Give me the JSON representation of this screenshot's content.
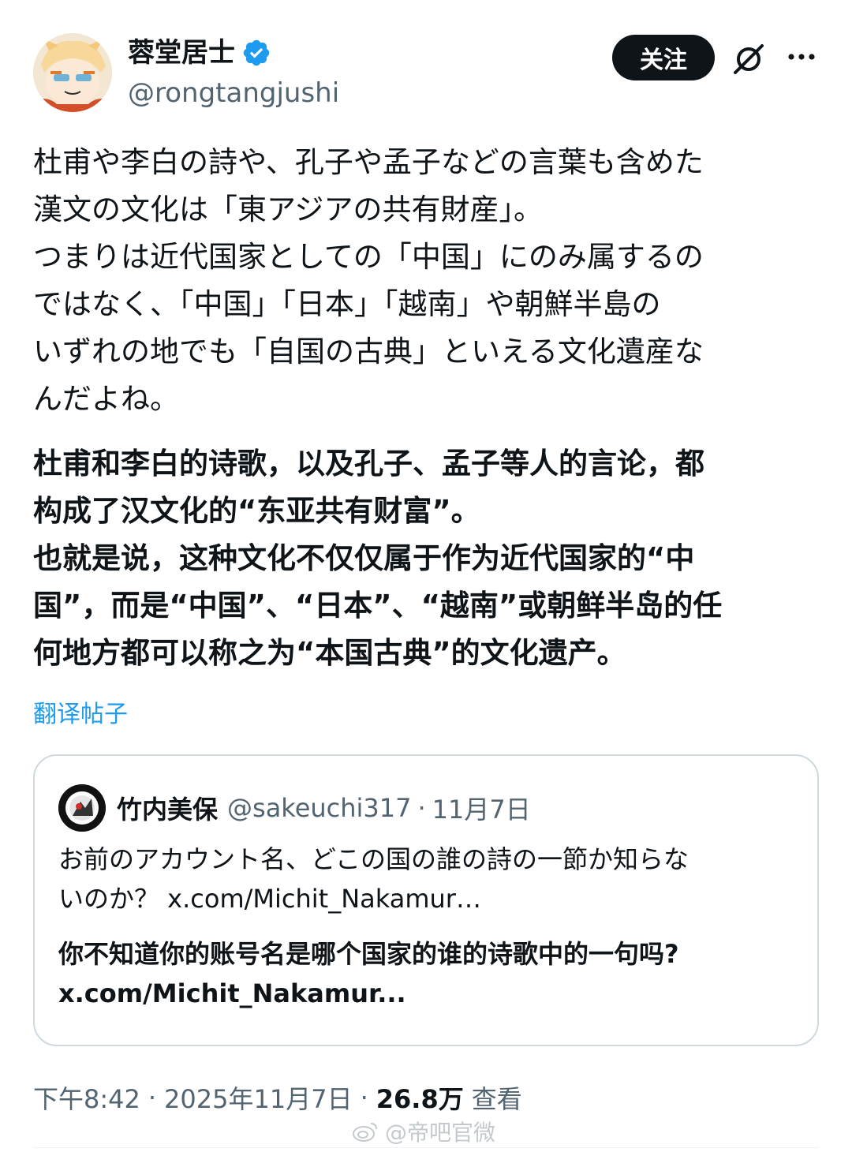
{
  "colors": {
    "accent": "#1d9bf0",
    "text_primary": "#0f1419",
    "text_secondary": "#536471",
    "follow_bg": "#0f1419",
    "card_border": "#cfd9de"
  },
  "author": {
    "display_name": "蓉堂居士",
    "handle": "@rongtangjushi",
    "verified_icon": "verified-badge-icon",
    "avatar": "anime-avatar"
  },
  "actions": {
    "follow_label": "关注",
    "grok_icon": "grok-icon",
    "more_icon": "more-horizontal-icon"
  },
  "post": {
    "text": "杜甫や李白の詩や、孔子や孟子などの言葉も含めた\n漢文の文化は「東アジアの共有財産」。\nつまりは近代国家としての「中国」にのみ属するの\nではなく、「中国」「日本」「越南」や朝鮮半島の\nいずれの地でも「自国の古典」といえる文化遺産な\nんだよね。",
    "translation": "杜甫和李白的诗歌，以及孔子、孟子等人的言论，都\n构成了汉文化的“东亚共有财富”。\n也就是说，这种文化不仅仅属于作为近代国家的“中\n国”，而是“中国”、“日本”、“越南”或朝鲜半岛的任\n何地方都可以称之为“本国古典”的文化遗产。",
    "translate_link": "翻译帖子"
  },
  "quote": {
    "display_name": "竹内美保",
    "handle": "@sakeuchi317",
    "separator": "·",
    "date": "11月7日",
    "text": "お前のアカウント名、どこの国の誰の詩の一節か知らな\nいのか？ x.com/Michit_Nakamur…",
    "translation": "你不知道你的账号名是哪个国家的谁的诗歌中的一句吗?\nx.com/Michit_Nakamur..."
  },
  "meta": {
    "time": "下午8:42",
    "separator": "·",
    "date": "2025年11月7日",
    "views_count": "26.8万",
    "views_label": "查看"
  },
  "watermark": {
    "text": "@帝吧官微",
    "icon": "weibo-icon"
  }
}
